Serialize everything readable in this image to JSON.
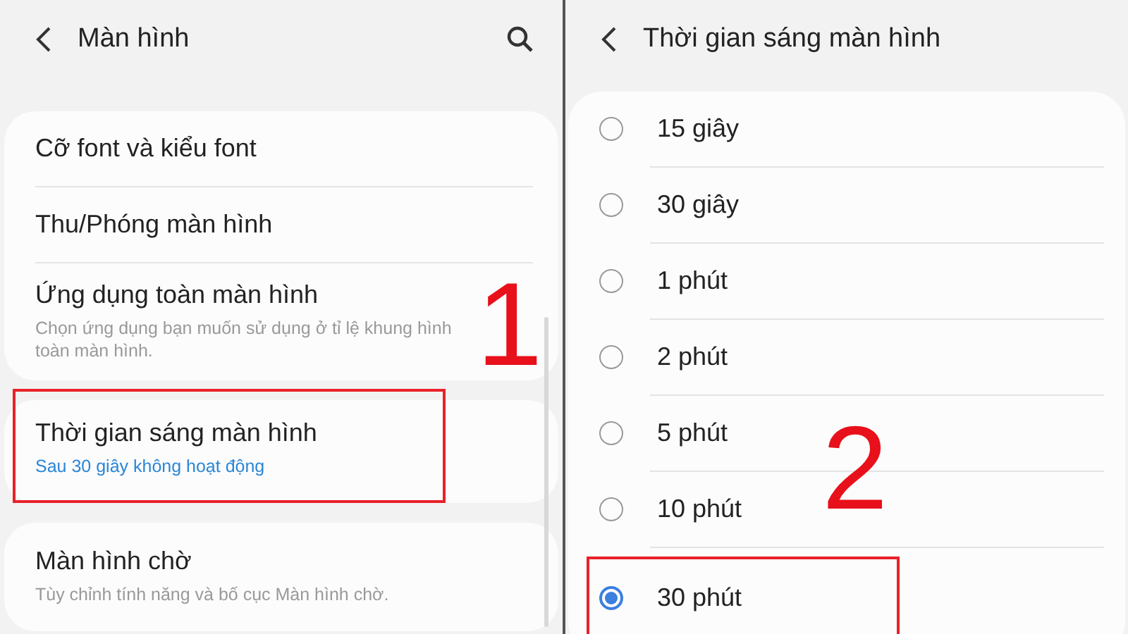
{
  "left_panel": {
    "title": "Màn hình",
    "groups": [
      {
        "items": [
          {
            "title": "Cỡ font và kiểu font",
            "highlighted": false
          },
          {
            "title": "Thu/Phóng màn hình",
            "highlighted": false
          },
          {
            "title": "Ứng dụng toàn màn hình",
            "subtitle": "Chọn ứng dụng bạn muốn sử dụng ở tỉ lệ khung hình toàn màn hình.",
            "kind": "detail",
            "highlighted": false
          }
        ]
      },
      {
        "items": [
          {
            "title": "Thời gian sáng màn hình",
            "subtitle": "Sau 30 giây không hoạt động",
            "kind": "value",
            "highlighted": true
          }
        ]
      },
      {
        "items": [
          {
            "title": "Màn hình chờ",
            "subtitle": "Tùy chỉnh tính năng và bố cục Màn hình chờ.",
            "kind": "detail",
            "highlighted": false
          }
        ]
      }
    ],
    "annotation": "1"
  },
  "right_panel": {
    "title": "Thời gian sáng màn hình",
    "options": [
      {
        "label": "15 giây",
        "selected": false,
        "highlighted": false
      },
      {
        "label": "30 giây",
        "selected": false,
        "highlighted": false
      },
      {
        "label": "1 phút",
        "selected": false,
        "highlighted": false
      },
      {
        "label": "2 phút",
        "selected": false,
        "highlighted": false
      },
      {
        "label": "5 phút",
        "selected": false,
        "highlighted": false
      },
      {
        "label": "10 phút",
        "selected": false,
        "highlighted": false
      },
      {
        "label": "30 phút",
        "selected": true,
        "highlighted": true
      }
    ],
    "annotation": "2"
  }
}
